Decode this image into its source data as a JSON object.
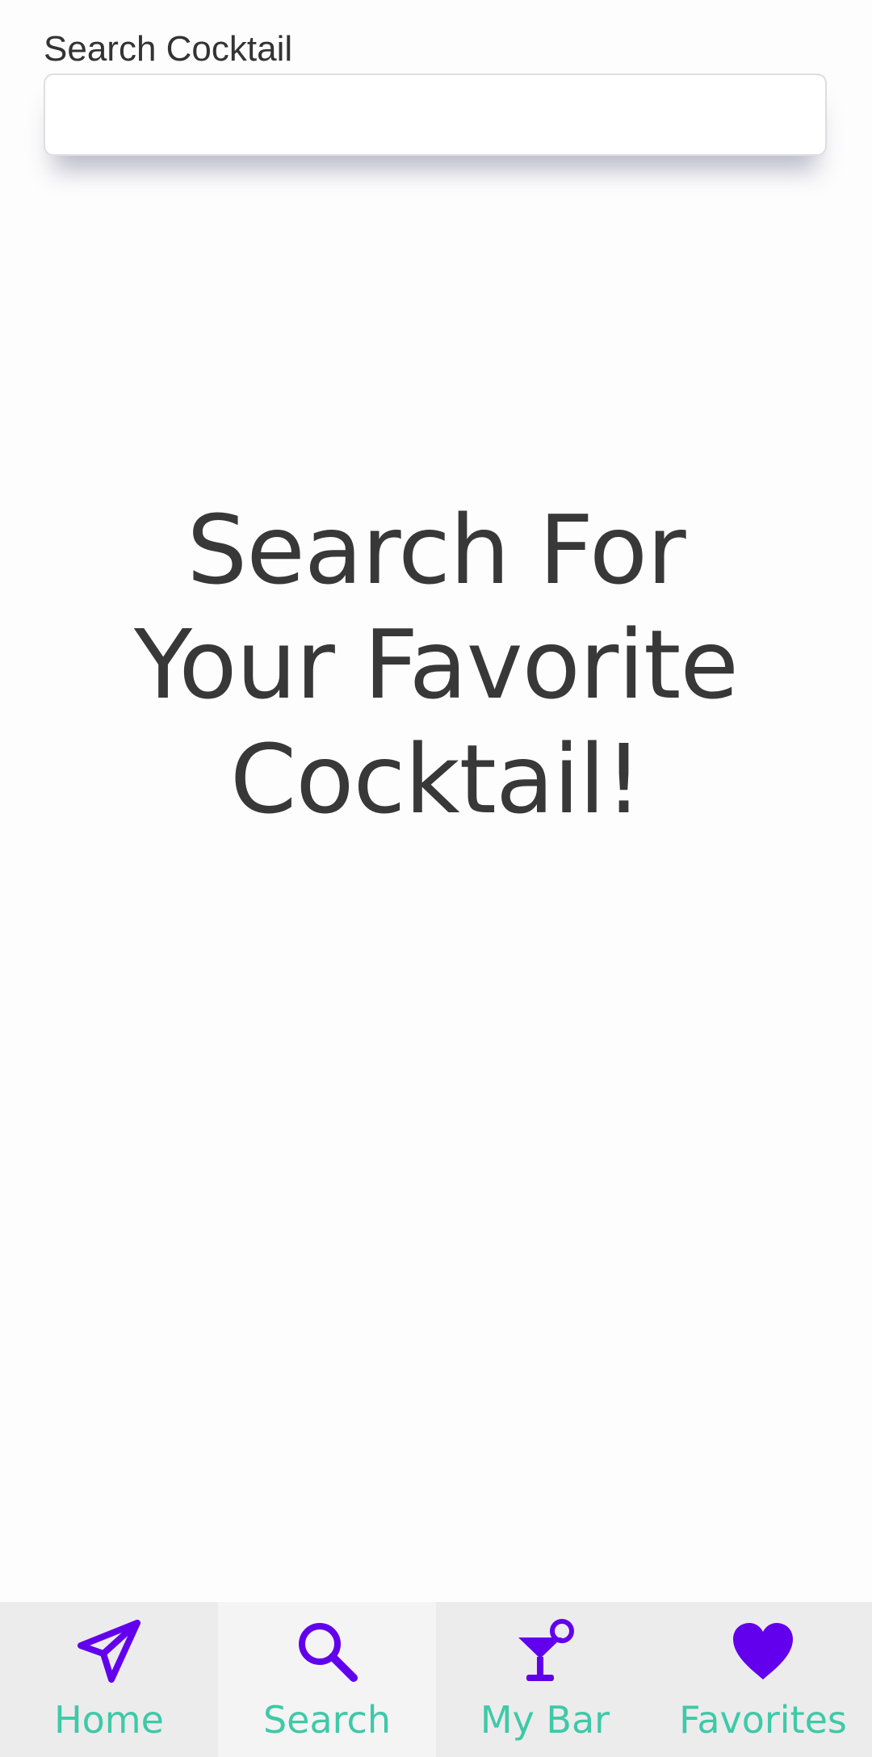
{
  "search": {
    "label": "Search Cocktail",
    "value": "",
    "placeholder": ""
  },
  "hero": {
    "line1": "Search For",
    "line2": "Your Favorite",
    "line3": "Cocktail!"
  },
  "colors": {
    "accent": "#6200ee",
    "tab_label": "#3ec9a7",
    "text": "#383838"
  },
  "tabs": [
    {
      "label": "Home",
      "icon": "paper-plane-icon",
      "active": false
    },
    {
      "label": "Search",
      "icon": "search-icon",
      "active": true
    },
    {
      "label": "My Bar",
      "icon": "cocktail-glass-icon",
      "active": false
    },
    {
      "label": "Favorites",
      "icon": "heart-icon",
      "active": false
    }
  ]
}
